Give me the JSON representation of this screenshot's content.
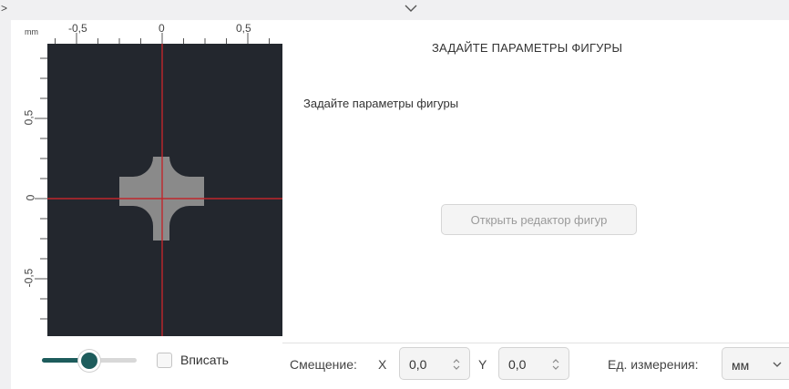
{
  "window": {
    "expand_left_glyph": ">",
    "collapse_top_icon": "chevron-down-icon"
  },
  "ruler": {
    "unit": "mm",
    "x_ticks": [
      "-0,5",
      "0",
      "0,5"
    ],
    "y_ticks": [
      "0,5",
      "0",
      "-0,5"
    ]
  },
  "preview": {
    "background_color": "#23272e",
    "shape_color": "#8a8a8a",
    "crosshair_color": "#c0262c"
  },
  "panel": {
    "title": "ЗАДАЙТЕ ПАРАМЕТРЫ ФИГУРЫ",
    "subtitle": "Задайте параметры фигуры",
    "open_editor_label": "Открыть редактор фигур"
  },
  "controls": {
    "zoom_slider_fraction": 0.5,
    "fit_label": "Вписать",
    "fit_checked": false,
    "offset_label": "Смещение:",
    "x_label": "X",
    "x_value": "0,0",
    "y_label": "Y",
    "y_value": "0,0",
    "units_label": "Ед. измерения:",
    "units_value": "мм",
    "accent_color": "#1d5c5c"
  }
}
